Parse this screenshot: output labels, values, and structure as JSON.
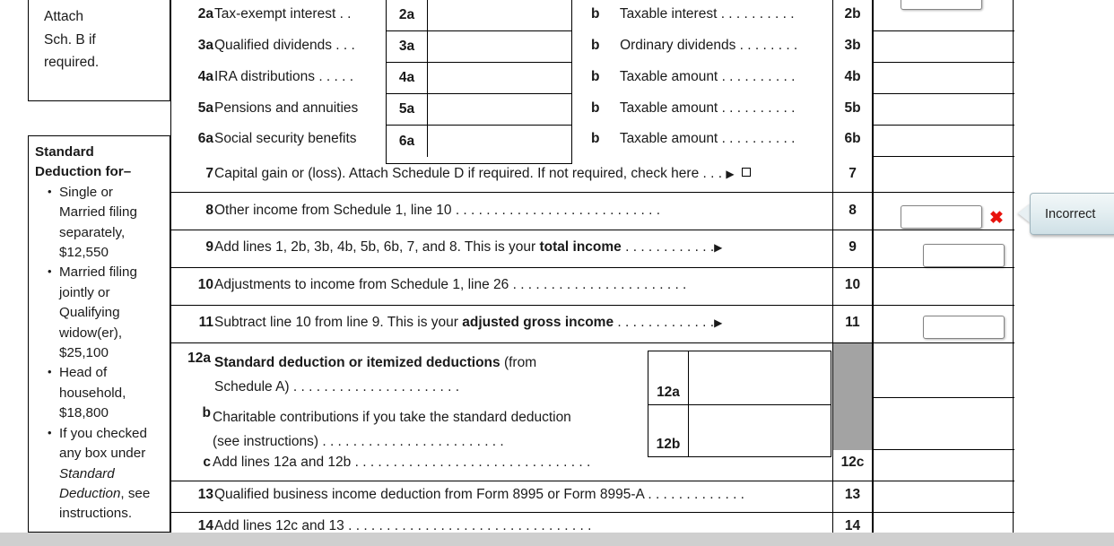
{
  "form": {
    "attach_note": [
      "Attach",
      "Sch. B if",
      "required."
    ],
    "standard_deduction": {
      "heading_line1": "Standard",
      "heading_line2": "Deduction for–",
      "items": [
        [
          "Single or",
          "Married filing",
          "separately,",
          "$12,550"
        ],
        [
          "Married filing",
          "jointly or",
          "Qualifying",
          "widow(er),",
          "$25,100"
        ],
        [
          "Head of",
          "household,",
          "$18,800"
        ]
      ],
      "last_item": {
        "pre": [
          "If you checked",
          "any box under"
        ],
        "italic": "Standard",
        "italic2": "Deduction",
        "post": ", see",
        "tail": "instructions."
      }
    },
    "rows": [
      {
        "id": "2",
        "a_num": "2a",
        "a_desc": "Tax-exempt interest",
        "a_leader": ". .",
        "a_box": "2a",
        "b_letter": "b",
        "b_desc": "Taxable interest",
        "b_leader": ". . . . . . . . . .",
        "b_num": "2b"
      },
      {
        "id": "3",
        "a_num": "3a",
        "a_desc": "Qualified dividends",
        "a_leader": ". . .",
        "a_box": "3a",
        "b_letter": "b",
        "b_desc": "Ordinary dividends",
        "b_leader": ". . . . . . . .",
        "b_num": "3b"
      },
      {
        "id": "4",
        "a_num": "4a",
        "a_desc": "IRA distributions",
        "a_leader": ". . . . .",
        "a_box": "4a",
        "b_letter": "b",
        "b_desc": "Taxable amount",
        "b_leader": ". . . . . . . . . .",
        "b_num": "4b"
      },
      {
        "id": "5",
        "a_num": "5a",
        "a_desc": "Pensions and annuities",
        "a_leader": "",
        "a_box": "5a",
        "b_letter": "b",
        "b_desc": "Taxable amount",
        "b_leader": ". . . . . . . . . .",
        "b_num": "5b"
      },
      {
        "id": "6",
        "a_num": "6a",
        "a_desc": "Social security benefits",
        "a_leader": "",
        "a_box": "6a",
        "b_letter": "b",
        "b_desc": "Taxable amount",
        "b_leader": ". . . . . . . . . .",
        "b_num": "6b"
      }
    ],
    "line7": {
      "num": "7",
      "text": "Capital gain or (loss). Attach Schedule D if required. If not required, check here",
      "leader": ". . .",
      "arrow": "▶",
      "rnum": "7"
    },
    "line8": {
      "num": "8",
      "text": "Other income from Schedule 1, line 10",
      "leader": ". . . . . . . . . . . . . . . . . . . . . . . . . . .",
      "rnum": "8",
      "value": "",
      "placeholder": ""
    },
    "line9": {
      "num": "9",
      "text_pre": "Add lines 1, 2b, 3b, 4b, 5b, 6b, 7, and 8. This is your ",
      "bold": "total income",
      "leader": ". . . . . . . . . . . .",
      "arrow": "▶",
      "rnum": "9",
      "value": "",
      "placeholder": ""
    },
    "line10": {
      "num": "10",
      "text": "Adjustments to income from Schedule 1, line 26",
      "leader": ". . . . . . . . . . . . . . . . . . . . . . .",
      "rnum": "10"
    },
    "line11": {
      "num": "11",
      "text_pre": "Subtract line 10 from line 9. This is your ",
      "bold": "adjusted gross income",
      "leader": ". . . . . . . . . . . . .",
      "arrow": "▶",
      "rnum": "11",
      "value": "",
      "placeholder": ""
    },
    "line12a": {
      "num": "12a",
      "bold": "Standard deduction or itemized deductions",
      "text_post": " (from",
      "line2": "Schedule A)",
      "leader": ". . . . . . . . . . . . . . . . . . . . . .",
      "box": "12a"
    },
    "line12b": {
      "num": "b",
      "line1": "Charitable contributions if you take the standard deduction",
      "line2": "(see instructions)",
      "leader": ". . . . . . . . . . . . . . . . . . . . . . . .",
      "box": "12b"
    },
    "line12c": {
      "num": "c",
      "text": "Add lines 12a and 12b",
      "leader": ". . . . . . . . . . . . . . . . . . . . . . . . . . . . . . .",
      "rnum": "12c"
    },
    "line13": {
      "num": "13",
      "text": "Qualified business income deduction from Form 8995 or Form 8995-A",
      "leader": ". . . . . . . . . . . . .",
      "rnum": "13"
    },
    "line14": {
      "num": "14",
      "text": "Add lines 12c and 13",
      "leader": ". . . . . . . . . . . . . . . . . . . . . . . . . . . . . . . .",
      "rnum": "14"
    }
  },
  "annotation": {
    "tooltip_text": "Incorrect",
    "error_mark": "✖",
    "error_color": "#e8120c"
  },
  "colors": {
    "gray_column": "#a3a3a3",
    "scrollbar": "#cfcfcf",
    "tooltip_border": "#9fb4bd"
  }
}
